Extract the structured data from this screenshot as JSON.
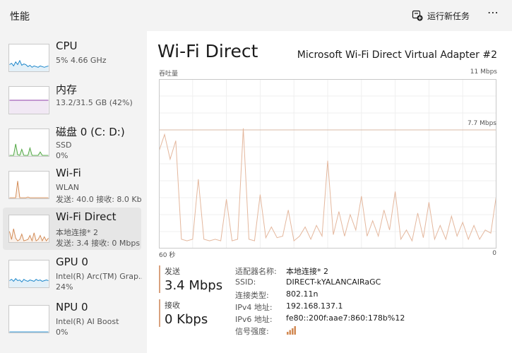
{
  "header": {
    "title": "性能",
    "run_task_label": "运行新任务",
    "more_label": "⋯"
  },
  "sidebar": {
    "items": [
      {
        "name": "CPU",
        "sub1": "5% 4.66 GHz",
        "sub2": "",
        "color": "#1583c9"
      },
      {
        "name": "内存",
        "sub1": "13.2/31.5 GB (42%)",
        "sub2": "",
        "color": "#8e3ea8"
      },
      {
        "name": "磁盘 0 (C: D:)",
        "sub1": "SSD",
        "sub2": "0%",
        "color": "#4aa33c"
      },
      {
        "name": "Wi-Fi",
        "sub1": "WLAN",
        "sub2": "发送: 40.0  接收: 8.0 Kb",
        "color": "#d28a54"
      },
      {
        "name": "Wi-Fi Direct",
        "sub1": "本地连接* 2",
        "sub2": "发送: 3.4  接收: 0 Mbps",
        "color": "#d28a54"
      },
      {
        "name": "GPU 0",
        "sub1": "Intel(R) Arc(TM) Grap...",
        "sub2": "24%",
        "color": "#1583c9"
      },
      {
        "name": "NPU 0",
        "sub1": "Intel(R) AI Boost",
        "sub2": "0%",
        "color": "#1583c9"
      }
    ]
  },
  "main": {
    "title": "Wi-Fi Direct",
    "adapter": "Microsoft Wi-Fi Direct Virtual Adapter #2",
    "throughput_label": "吞吐量",
    "max_label": "11 Mbps",
    "ref_label": "7.7 Mbps",
    "time_left": "60 秒",
    "time_right": "0",
    "send_label": "发送",
    "send_value": "3.4 Mbps",
    "recv_label": "接收",
    "recv_value": "0 Kbps",
    "properties": [
      {
        "k": "适配器名称:",
        "v": "本地连接* 2"
      },
      {
        "k": "SSID:",
        "v": "DIRECT-kYALANCAIRaGC"
      },
      {
        "k": "连接类型:",
        "v": "802.11n"
      },
      {
        "k": "IPv4 地址:",
        "v": "192.168.137.1"
      },
      {
        "k": "IPv6 地址:",
        "v": "fe80::200f:aae7:860:178b%12"
      },
      {
        "k": "信号强度:",
        "v": ""
      }
    ]
  },
  "chart_data": {
    "type": "line",
    "xlabel": "60 秒",
    "ylabel": "吞吐量",
    "ylim": [
      0,
      11
    ],
    "xlim": [
      60,
      0
    ],
    "reference_line": 7.7,
    "grid": true,
    "series": [
      {
        "x": [
          60,
          59,
          58,
          57,
          56,
          55,
          54,
          53,
          52,
          51,
          50,
          49,
          48,
          47,
          46,
          45,
          44,
          43,
          42,
          41,
          40,
          39,
          38,
          37,
          36,
          35,
          34,
          33,
          32,
          31,
          30,
          29,
          28,
          27,
          26,
          25,
          24,
          23,
          22,
          21,
          20,
          19,
          18,
          17,
          16,
          15,
          14,
          13,
          12,
          11,
          10,
          9,
          8,
          7,
          6,
          5,
          4,
          3,
          2,
          1,
          0
        ],
        "values": [
          6.3,
          7.4,
          5.8,
          7.0,
          0.6,
          0.5,
          0.6,
          4.5,
          0.6,
          0.5,
          0.6,
          0.5,
          3.2,
          0.5,
          0.6,
          7.8,
          0.6,
          0.5,
          3.5,
          0.7,
          1.4,
          0.7,
          0.8,
          2.5,
          0.5,
          0.8,
          1.4,
          0.6,
          1.5,
          0.8,
          5.7,
          0.9,
          2.4,
          0.8,
          2.2,
          1.2,
          3.4,
          0.8,
          1.8,
          0.8,
          2.5,
          1.2,
          3.7,
          0.6,
          1.2,
          0.5,
          2.3,
          0.7,
          3.0,
          0.6,
          1.5,
          0.6,
          2.1,
          0.8,
          1.7,
          0.6,
          1.5,
          0.6,
          1.2,
          1.0,
          3.5
        ]
      }
    ]
  }
}
